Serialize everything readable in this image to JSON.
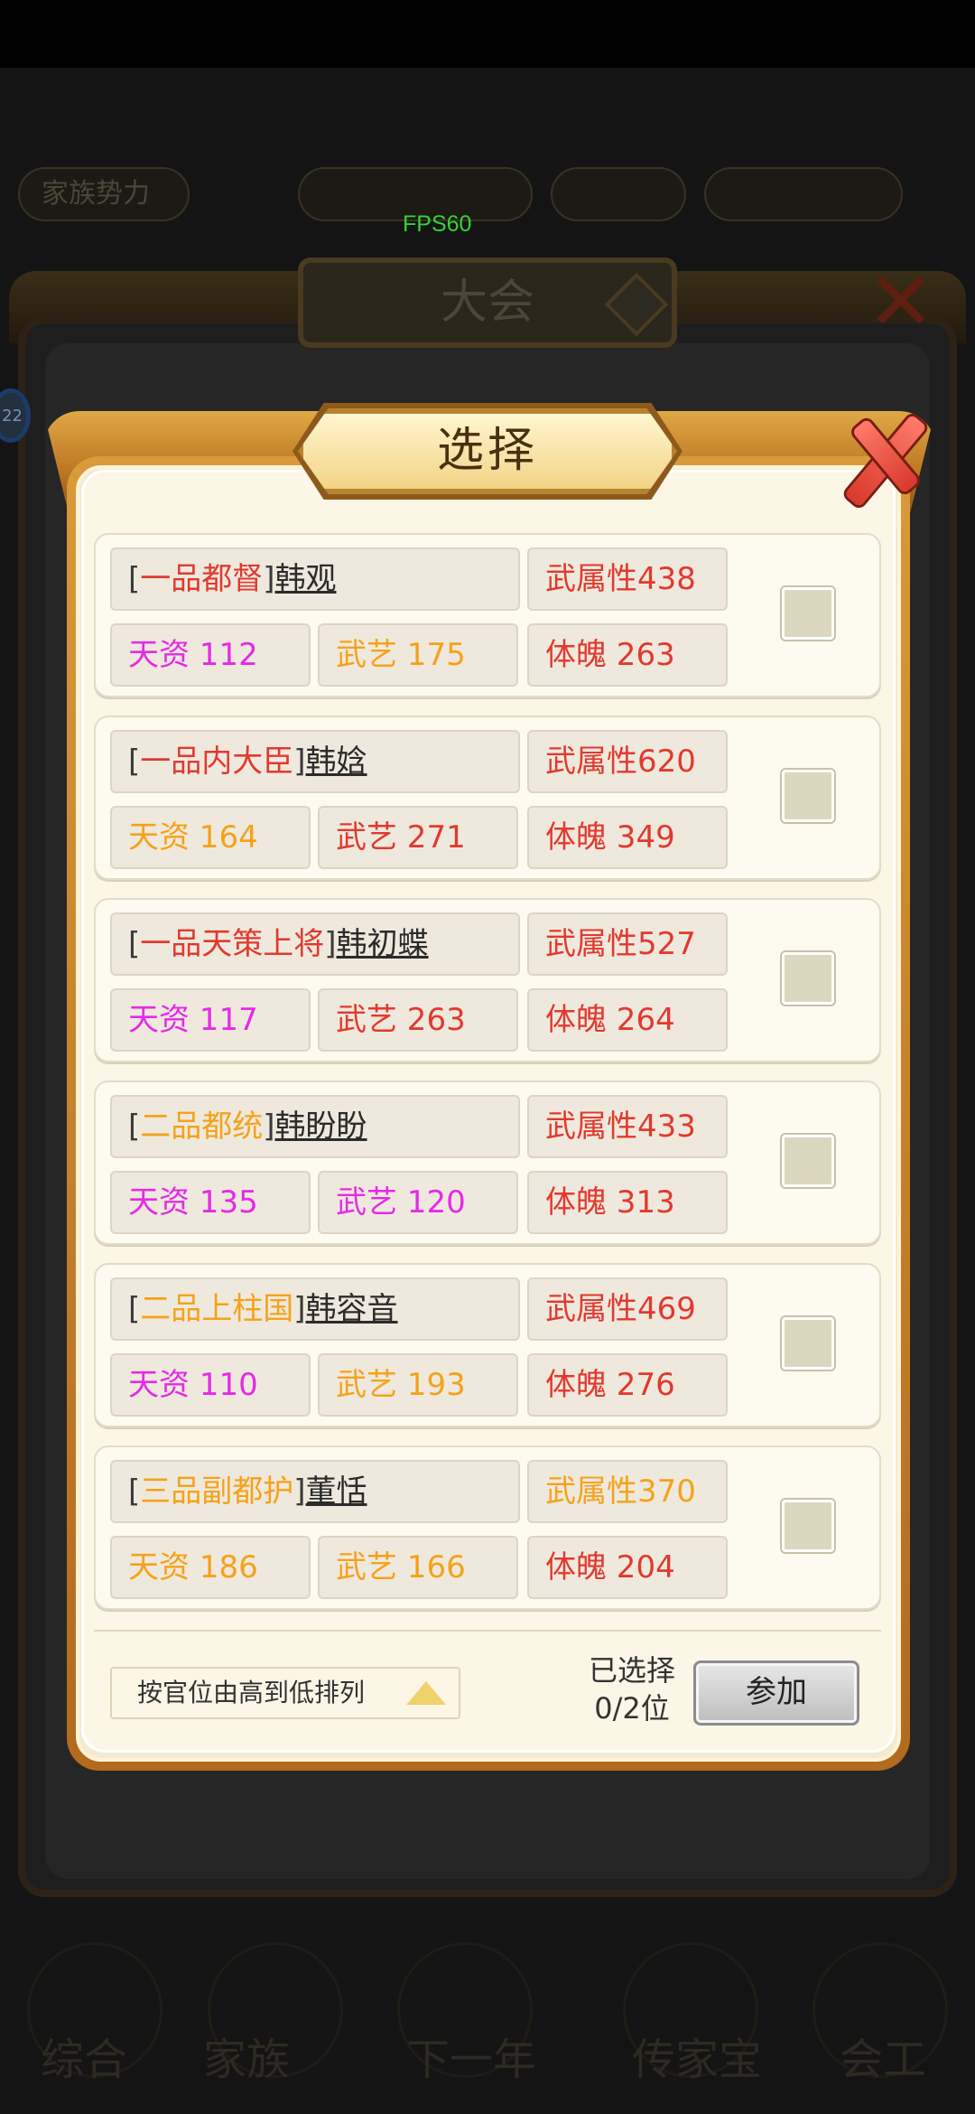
{
  "overlay": {
    "fps_text": "FPS60",
    "parent_title": "大会",
    "top_pills": [
      "家族势力",
      "",
      "",
      ""
    ],
    "side_badge": "22",
    "bottom_nav": [
      "综合",
      "家族",
      "下一年",
      "传家宝",
      "会工"
    ]
  },
  "dialog": {
    "title": "选择",
    "candidates": [
      {
        "rank": "一品都督",
        "rank_color": "#e2392f",
        "name": "韩观",
        "attr": "武属性438",
        "attr_color": "#e2392f",
        "talent": "天资 112",
        "talent_color": "#e62ae6",
        "skill": "武艺 175",
        "skill_color": "#f5a21a",
        "physique": "体魄 263",
        "physique_color": "#e2392f",
        "checked": false
      },
      {
        "rank": "一品内大臣",
        "rank_color": "#e2392f",
        "name": "韩娢",
        "attr": "武属性620",
        "attr_color": "#e2392f",
        "talent": "天资 164",
        "talent_color": "#f5a21a",
        "skill": "武艺 271",
        "skill_color": "#e2392f",
        "physique": "体魄 349",
        "physique_color": "#e2392f",
        "checked": false
      },
      {
        "rank": "一品天策上将",
        "rank_color": "#e2392f",
        "name": "韩初蝶",
        "attr": "武属性527",
        "attr_color": "#e2392f",
        "talent": "天资 117",
        "talent_color": "#e62ae6",
        "skill": "武艺 263",
        "skill_color": "#e2392f",
        "physique": "体魄 264",
        "physique_color": "#e2392f",
        "checked": false
      },
      {
        "rank": "二品都统",
        "rank_color": "#f5a21a",
        "name": "韩盼盼",
        "attr": "武属性433",
        "attr_color": "#e2392f",
        "talent": "天资 135",
        "talent_color": "#e62ae6",
        "skill": "武艺 120",
        "skill_color": "#e62ae6",
        "physique": "体魄 313",
        "physique_color": "#e2392f",
        "checked": false
      },
      {
        "rank": "二品上柱国",
        "rank_color": "#f5a21a",
        "name": "韩容音",
        "attr": "武属性469",
        "attr_color": "#e2392f",
        "talent": "天资 110",
        "talent_color": "#e62ae6",
        "skill": "武艺 193",
        "skill_color": "#f5a21a",
        "physique": "体魄 276",
        "physique_color": "#e2392f",
        "checked": false
      },
      {
        "rank": "三品副都护",
        "rank_color": "#f5a21a",
        "name": "董恬",
        "attr": "武属性370",
        "attr_color": "#f5a21a",
        "talent": "天资 186",
        "talent_color": "#f5a21a",
        "skill": "武艺 166",
        "skill_color": "#f5a21a",
        "physique": "体魄 204",
        "physique_color": "#e2392f",
        "checked": false
      }
    ],
    "sort_label": "按官位由高到低排列",
    "selected_label": "已选择",
    "selected_count": "0/2位",
    "join_label": "参加"
  }
}
